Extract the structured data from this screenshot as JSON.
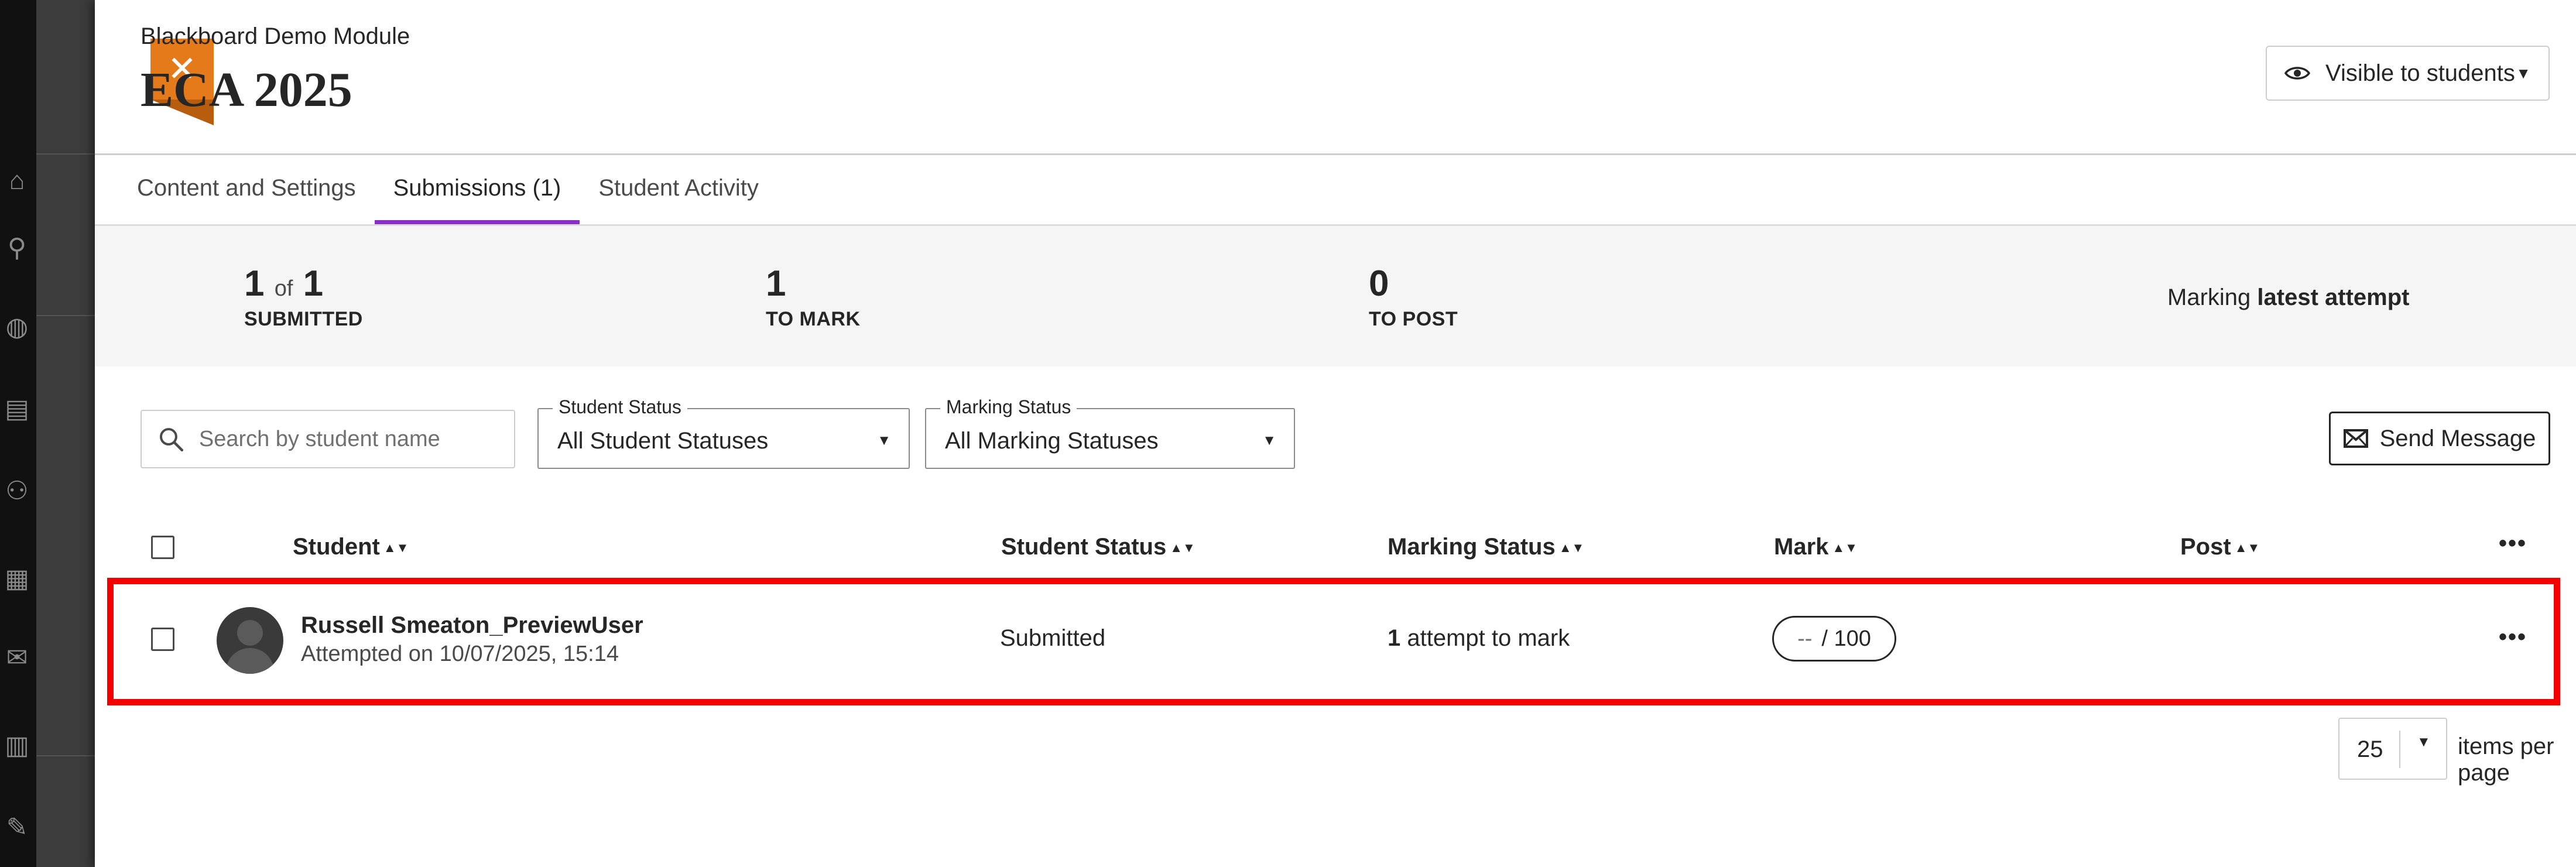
{
  "header": {
    "course_name": "Blackboard Demo Module",
    "title": "ECA 2025",
    "visibility_label": "Visible to students",
    "close_icon": "close-icon"
  },
  "tabs": [
    {
      "label": "Content and Settings",
      "active": false
    },
    {
      "label": "Submissions (1)",
      "active": true
    },
    {
      "label": "Student Activity",
      "active": false
    }
  ],
  "summary": {
    "submitted_count": "1",
    "submitted_of": "of",
    "submitted_total": "1",
    "submitted_label": "SUBMITTED",
    "to_mark_count": "1",
    "to_mark_label": "TO MARK",
    "to_post_count": "0",
    "to_post_label": "TO POST",
    "marking_prefix": "Marking",
    "marking_strong": "latest attempt"
  },
  "filters": {
    "search_placeholder": "Search by student name",
    "student_status_legend": "Student Status",
    "student_status_value": "All Student Statuses",
    "marking_status_legend": "Marking Status",
    "marking_status_value": "All Marking Statuses",
    "send_message_label": "Send Message"
  },
  "table": {
    "columns": [
      "Student",
      "Student Status",
      "Marking Status",
      "Mark",
      "Post"
    ],
    "rows": [
      {
        "name": "Russell Smeaton_PreviewUser",
        "attempted": "Attempted on 10/07/2025, 15:14",
        "student_status": "Submitted",
        "marking_count": "1",
        "marking_text": "attempt to mark",
        "mark_value": "--",
        "mark_total": "/ 100"
      }
    ],
    "more_icon": "•••"
  },
  "pagination": {
    "per_page_value": "25",
    "per_page_label": "items per page"
  },
  "colors": {
    "accent_tab": "#8b2ec7",
    "close_button": "#e57a1a",
    "highlight": "#f50000"
  }
}
